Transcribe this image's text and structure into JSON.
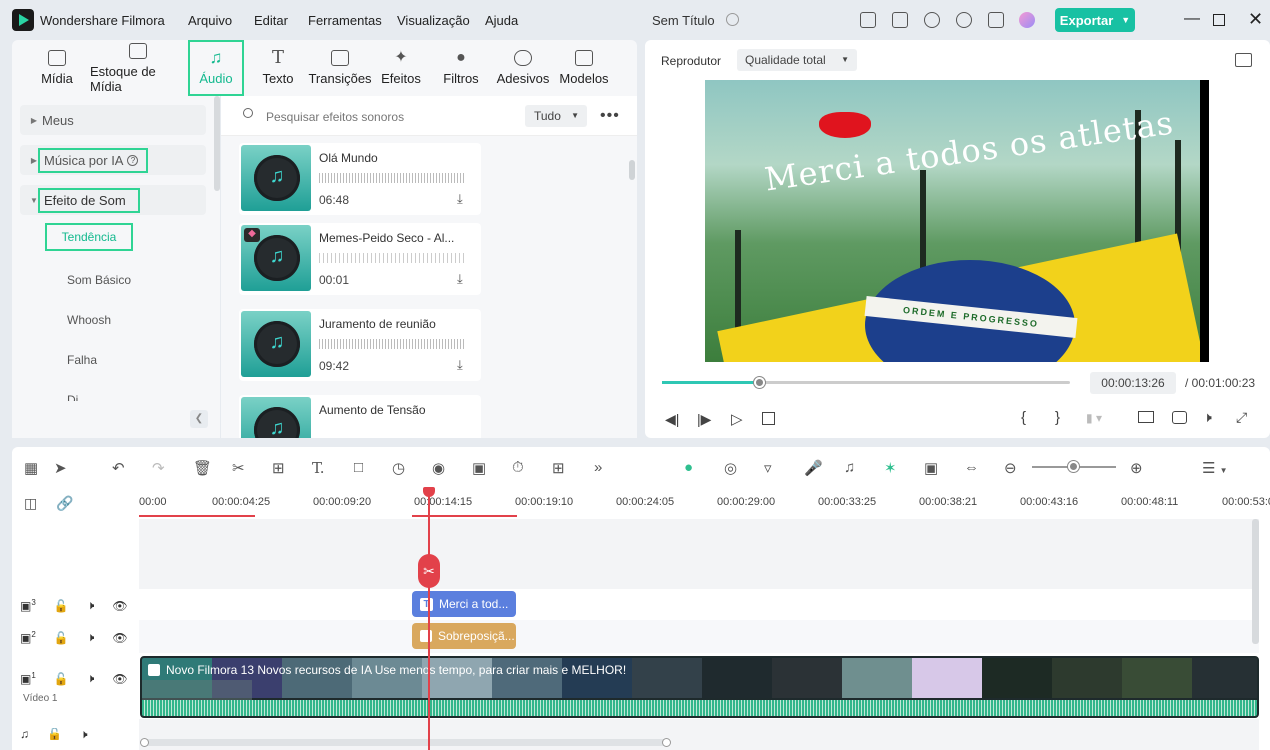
{
  "app": {
    "title": "Wondershare Filmora",
    "doc_title": "Sem Título",
    "export_label": "Exportar",
    "accent": "#18c1a3"
  },
  "menu": [
    "Arquivo",
    "Editar",
    "Ferramentas",
    "Visualização",
    "Ajuda"
  ],
  "tabs": [
    {
      "label": "Mídia",
      "icon": "media-icon"
    },
    {
      "label": "Estoque de Mídia",
      "icon": "stock-media-icon"
    },
    {
      "label": "Áudio",
      "icon": "music-note-icon",
      "active": true
    },
    {
      "label": "Texto",
      "icon": "text-icon"
    },
    {
      "label": "Transições",
      "icon": "transitions-icon"
    },
    {
      "label": "Efeitos",
      "icon": "effects-icon"
    },
    {
      "label": "Filtros",
      "icon": "filters-icon"
    },
    {
      "label": "Adesivos",
      "icon": "stickers-icon"
    },
    {
      "label": "Modelos",
      "icon": "templates-icon"
    }
  ],
  "sidebar": {
    "items": [
      "Meus",
      "Música por IA",
      "Efeito de Som"
    ],
    "subitems": [
      "Tendência",
      "Som Básico",
      "Whoosh",
      "Falha",
      "Di..."
    ]
  },
  "search": {
    "placeholder": "Pesquisar efeitos sonoros",
    "filter": "Tudo"
  },
  "sounds": [
    {
      "title": "Olá Mundo",
      "duration": "06:48"
    },
    {
      "title": "Memes-Peido Seco - Al...",
      "duration": "00:01"
    },
    {
      "title": "Juramento de reunião",
      "duration": "09:42"
    },
    {
      "title": "Aumento de Tensão",
      "duration": ""
    }
  ],
  "player": {
    "label": "Reprodutor",
    "quality": "Qualidade total",
    "current_time": "00:00:13:26",
    "total_time": "/ 00:01:00:23",
    "progress": 0.23,
    "video_text": "Merci a todos os atletas",
    "banner_text": "ORDEM E PROGRESSO"
  },
  "ruler": [
    "00:00",
    "00:00:04:25",
    "00:00:09:20",
    "00:00:14:15",
    "00:00:19:10",
    "00:00:24:05",
    "00:00:29:00",
    "00:00:33:25",
    "00:00:38:21",
    "00:00:43:16",
    "00:00:48:11",
    "00:00:53:0"
  ],
  "tracks": {
    "track3": "3",
    "track2": "2",
    "track1": "1",
    "track1_name": "Vídeo 1",
    "text_clip": "Merci a tod...",
    "overlay_clip": "Sobreposiçã...",
    "video_clip": "Novo Filmora 13 Novos recursos de IA  Use menos tempo, para criar mais e MELHOR!"
  }
}
